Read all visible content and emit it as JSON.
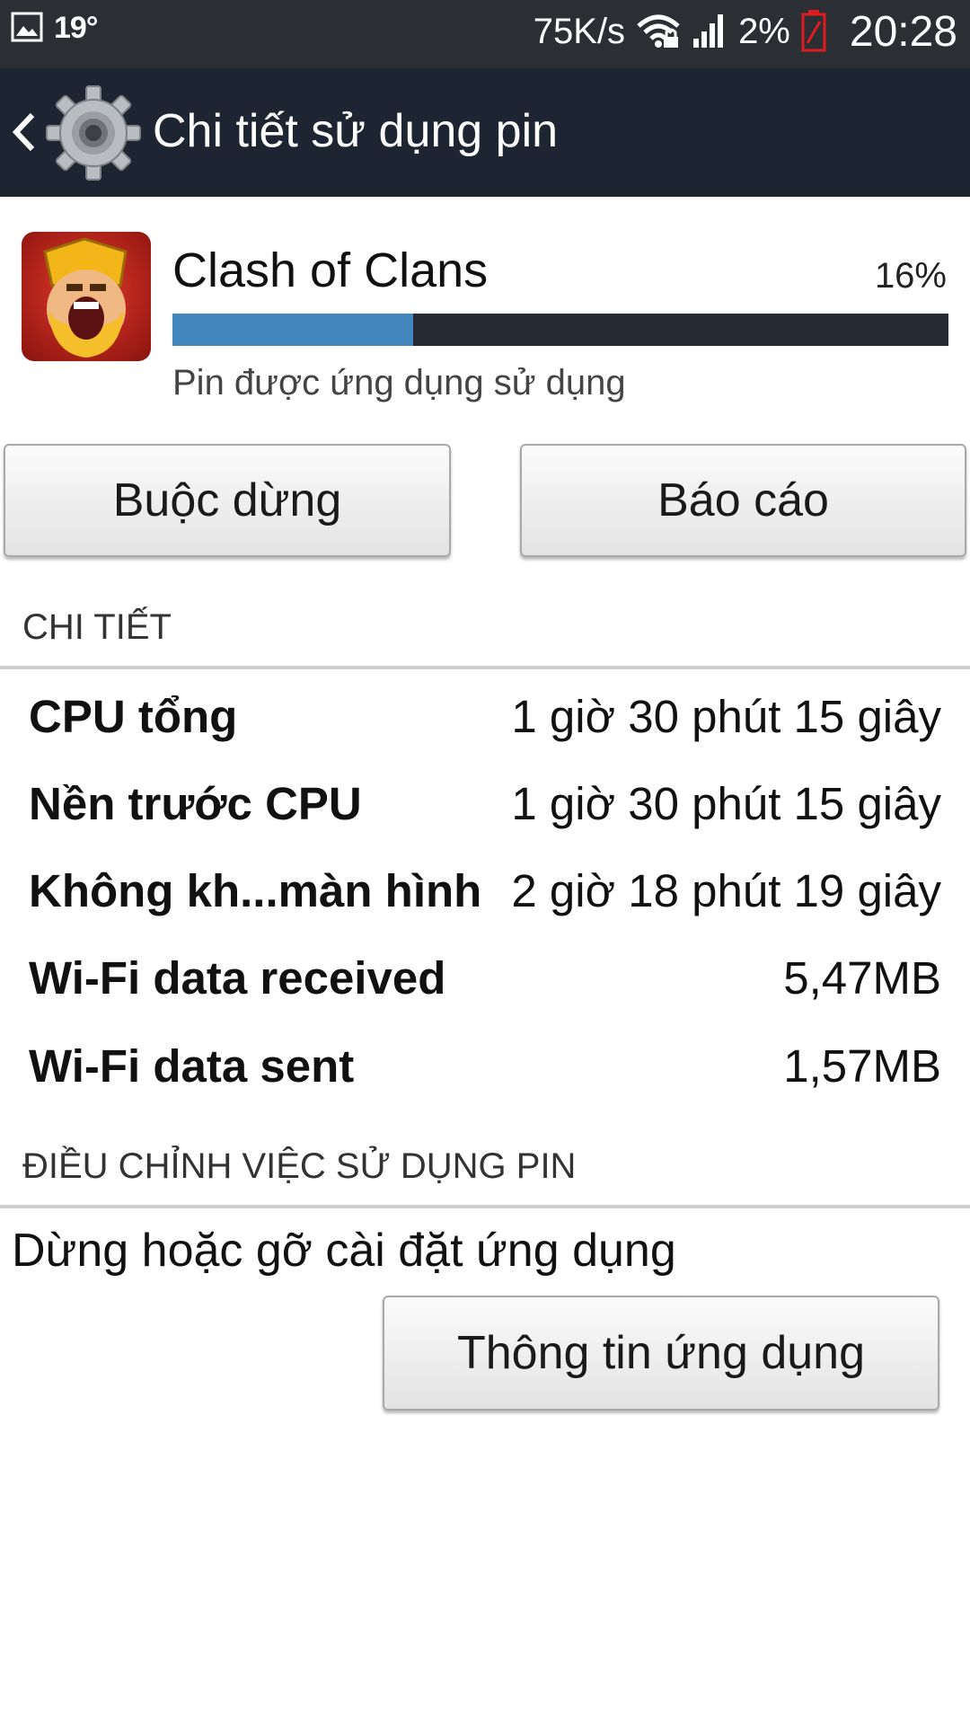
{
  "status_bar": {
    "temperature": "19°",
    "network_speed": "75K/s",
    "battery_percent": "2%",
    "time": "20:28",
    "icons": [
      "image-icon",
      "wifi-icon",
      "signal-icon",
      "battery-low-icon"
    ],
    "battery_color": "#e11b22"
  },
  "action_bar": {
    "title": "Chi tiết sử dụng pin",
    "background": "#1c2531"
  },
  "app": {
    "name": "Clash of Clans",
    "percent": "16%",
    "usage_fraction": 0.31,
    "subtitle": "Pin được ứng dụng sử dụng",
    "bar_color": "#4187bd"
  },
  "buttons": {
    "force_stop": "Buộc dừng",
    "report": "Báo cáo",
    "app_info": "Thông tin ứng dụng"
  },
  "details": {
    "header": "CHI TIẾT",
    "rows": [
      {
        "label": "CPU tổng",
        "value": "1 giờ 30 phút 15 giây"
      },
      {
        "label": "Nền trước CPU",
        "value": "1 giờ 30 phút 15 giây"
      },
      {
        "label": "Không kh...màn hình",
        "value": "2 giờ 18 phút 19 giây"
      },
      {
        "label": "Wi-Fi data received",
        "value": "5,47MB"
      },
      {
        "label": "Wi-Fi data sent",
        "value": "1,57MB"
      }
    ]
  },
  "adjust": {
    "header": "ĐIỀU CHỈNH VIỆC SỬ DỤNG PIN",
    "description": "Dừng hoặc gỡ cài đặt ứng dụng"
  }
}
